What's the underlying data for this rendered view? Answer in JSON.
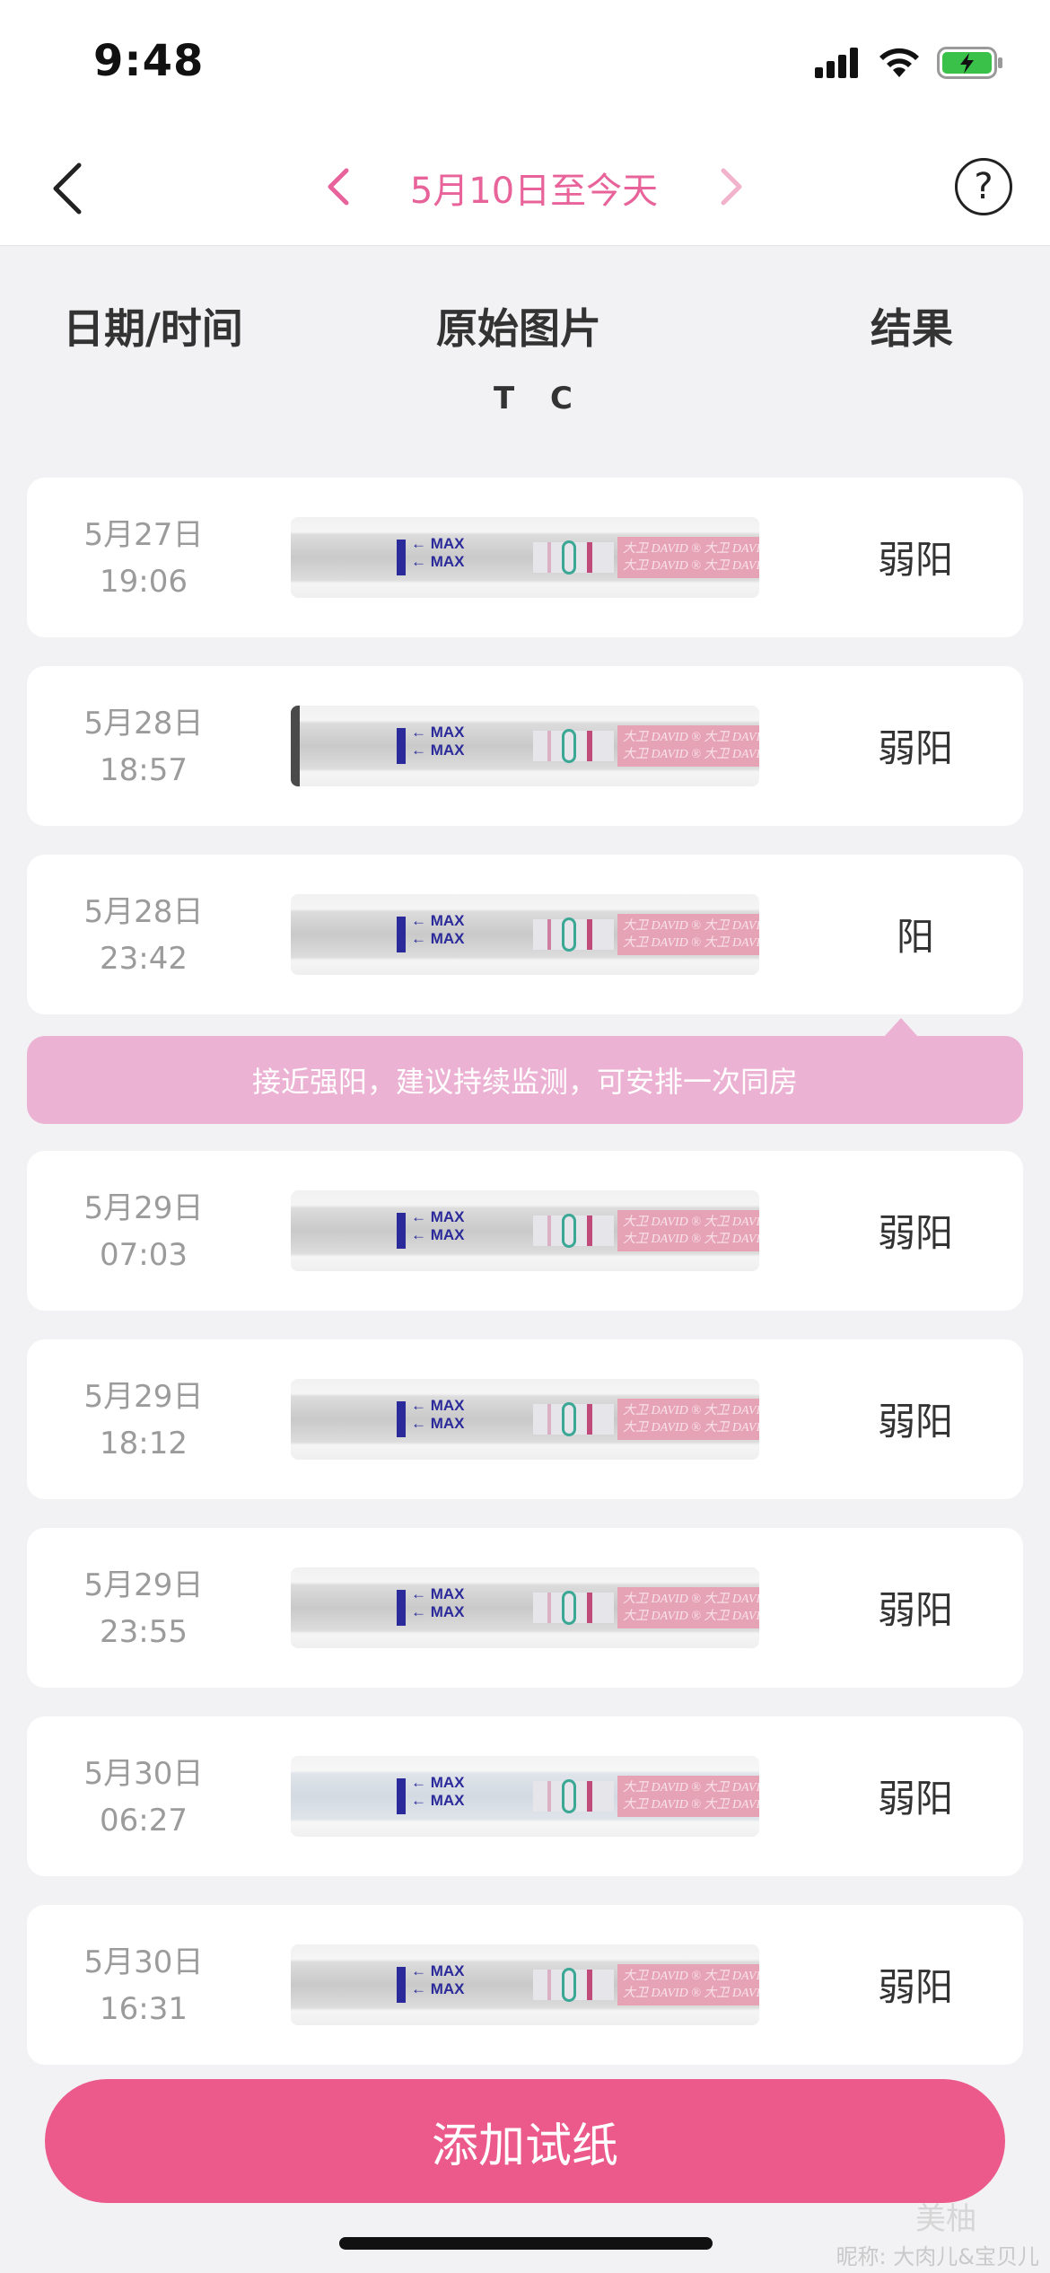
{
  "status_bar": {
    "time": "9:48"
  },
  "nav": {
    "range_label": "5月10日至今天",
    "help_label": "?"
  },
  "columns": {
    "date_time": "日期/时间",
    "image": "原始图片",
    "result": "结果",
    "tc_label": "T C"
  },
  "records": [
    {
      "date": "5月27日",
      "time": "19:06",
      "result": "弱阳"
    },
    {
      "date": "5月28日",
      "time": "18:57",
      "result": "弱阳"
    },
    {
      "date": "5月28日",
      "time": "23:42",
      "result": "阳"
    },
    {
      "date": "5月29日",
      "time": "07:03",
      "result": "弱阳"
    },
    {
      "date": "5月29日",
      "time": "18:12",
      "result": "弱阳"
    },
    {
      "date": "5月29日",
      "time": "23:55",
      "result": "弱阳"
    },
    {
      "date": "5月30日",
      "time": "06:27",
      "result": "弱阳"
    },
    {
      "date": "5月30日",
      "time": "16:31",
      "result": "弱阳"
    }
  ],
  "strip_text": {
    "max": "MAX",
    "brand": "大卫 DAVID ® 大卫 DAVID ®"
  },
  "tip": "接近强阳，建议持续监测，可安排一次同房",
  "add_button": "添加试纸",
  "watermark": {
    "logo": "美柚",
    "text": "昵称: 大肉儿&宝贝儿"
  },
  "colors": {
    "accent": "#ec5a8b",
    "tip_bg": "#ecb2d3",
    "nav_pink": "#e8639a"
  }
}
